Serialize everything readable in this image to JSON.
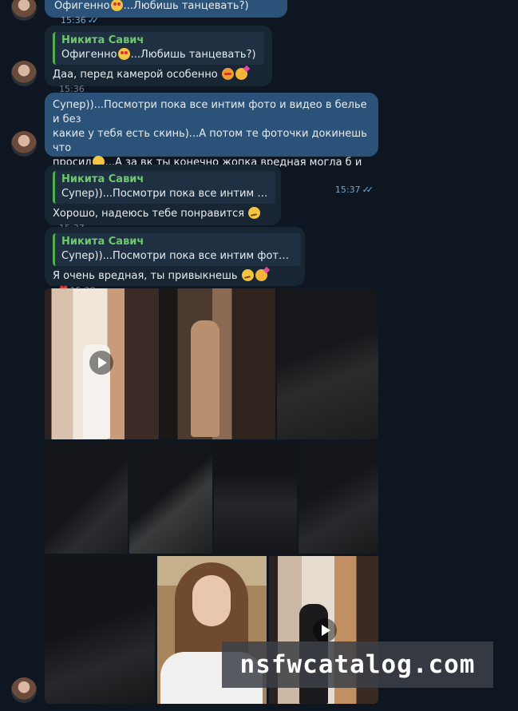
{
  "messages": {
    "m1": {
      "text": "Офигенно",
      "text_after": "...Любишь танцевать?)",
      "time": "15:36",
      "status": "read"
    },
    "m2": {
      "reply_name": "Никита Савич",
      "reply_text": "Офигенно",
      "reply_text_after": "...Любишь танцевать?)",
      "text": "Даа, перед камерой особенно",
      "time": "15:36"
    },
    "m3": {
      "line1": "Супер))...Посмотри пока все интим фото и видео в белье и без",
      "line2": "какие у тебя есть скинь)...А потом те фоточки докинешь что",
      "line3_a": "просил",
      "line3_b": "...А за вк ты конечно жопка вредная могла б и скинуть)",
      "time": "15:37",
      "status": "read"
    },
    "m4": {
      "reply_name": "Никита Савич",
      "reply_text": "Супер))...Посмотри пока все интим фото ...",
      "text": "Хорошо, надеюсь тебе понравится",
      "time": "15:37"
    },
    "m5": {
      "reply_name": "Никита Савич",
      "reply_text": "Супер))...Посмотри пока все интим фото и вид...",
      "text": "Я очень вредная, ты привыкнешь",
      "time": "15:38",
      "reaction": "heart"
    }
  },
  "icons": {
    "read_ticks": "double-check-icon",
    "reaction": "heart-icon",
    "play": "play-icon"
  },
  "colors": {
    "background": "#0e1621",
    "incoming_bubble": "#182533",
    "outgoing_bubble": "#2b5278",
    "reply_accent": "#4fae4e",
    "reply_name": "#6ec86d",
    "ticks": "#6ab3f3"
  },
  "watermark": "nsfwcatalog.com"
}
